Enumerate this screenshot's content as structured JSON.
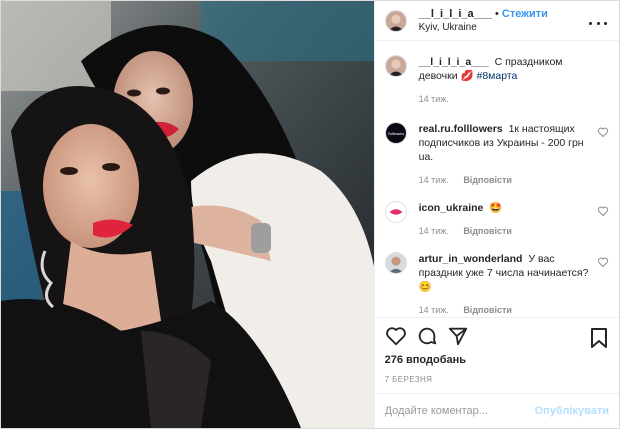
{
  "post": {
    "username": "__l_i_l_i_a___",
    "follow_label": "Стежити",
    "location": "Kyiv, Ukraine",
    "dot": "•"
  },
  "icons": [
    "more-options-icon",
    "heart-icon",
    "comment-icon",
    "share-icon",
    "bookmark-icon"
  ],
  "caption": {
    "username": "__l_i_l_i_a___",
    "text": "С праздником девочки 💋",
    "hashtag": "#8марта",
    "time": "14 тиж."
  },
  "comments": [
    {
      "username": "real.ru.folllowers",
      "text": "1к настоящих подписчиков из Украины - 200 грн ua.",
      "time": "14 тиж.",
      "reply_label": "Відповісти",
      "avatar_text": "Folllowers"
    },
    {
      "username": "icon_ukraine",
      "text": "🤩",
      "time": "14 тиж.",
      "reply_label": "Відповісти"
    },
    {
      "username": "artur_in_wonderland",
      "text": "У вас праздник уже 7 числа начинается? 😊",
      "time": "14 тиж.",
      "reply_label": "Відповісти"
    }
  ],
  "likes": "276 вподобань",
  "date": "7 БЕРЕЗНЯ",
  "comment_input": {
    "placeholder": "Додайте коментар..."
  },
  "publish_label": "Опублікувати",
  "colors": {
    "link_blue": "#3897f0",
    "hashtag": "#003569",
    "muted": "#8e8e8e",
    "publish_disabled": "#b2dffc"
  }
}
